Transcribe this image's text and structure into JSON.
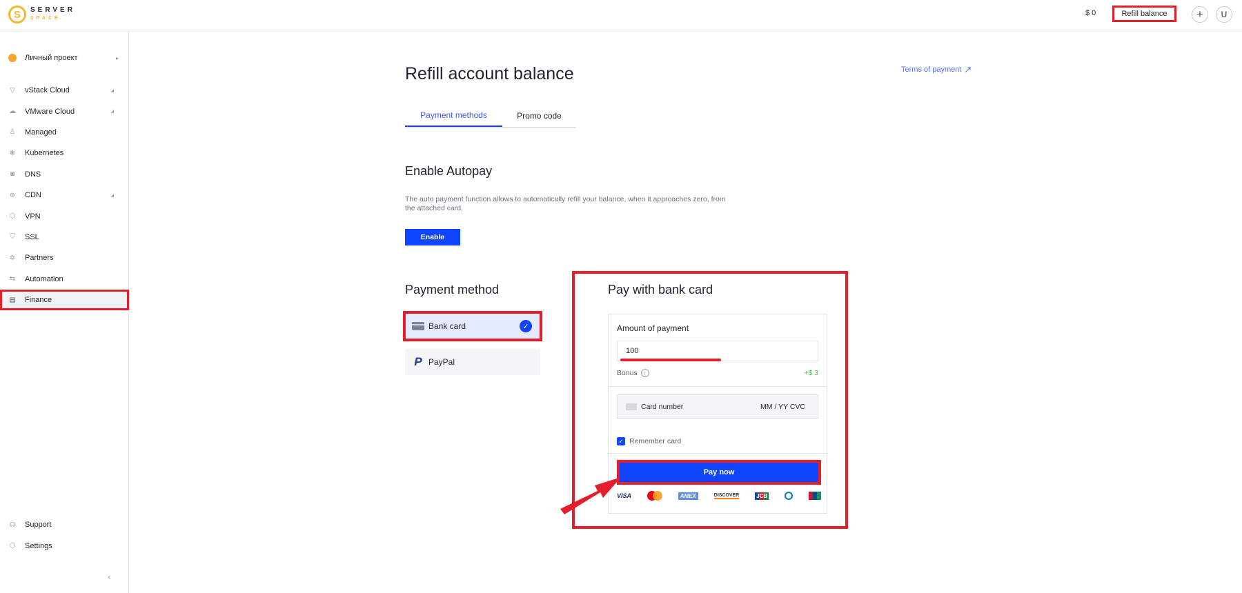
{
  "header": {
    "logo": {
      "line1": "SERVER",
      "line2": "SPACE"
    },
    "balance": "$ 0",
    "refill_button": "Refill balance",
    "add_button": "+",
    "user_initial": "U"
  },
  "sidebar": {
    "project": {
      "label": "Личный проект",
      "arrow": "▸"
    },
    "items": [
      {
        "label": "vStack Cloud",
        "icon": "▽",
        "caret": "◢"
      },
      {
        "label": "VMware Cloud",
        "icon": "☁",
        "caret": "◢"
      },
      {
        "label": "Managed",
        "icon": "♙",
        "caret": ""
      },
      {
        "label": "Kubernetes",
        "icon": "❃",
        "caret": ""
      },
      {
        "label": "DNS",
        "icon": "◙",
        "caret": ""
      },
      {
        "label": "CDN",
        "icon": "⊕",
        "caret": "◢"
      },
      {
        "label": "VPN",
        "icon": "⬡",
        "caret": ""
      },
      {
        "label": "SSL",
        "icon": "⛉",
        "caret": ""
      },
      {
        "label": "Partners",
        "icon": "✲",
        "caret": ""
      },
      {
        "label": "Automation",
        "icon": "⇆",
        "caret": ""
      },
      {
        "label": "Finance",
        "icon": "▤",
        "caret": "",
        "active": true
      }
    ],
    "bottom_items": [
      {
        "label": "Support",
        "icon": "☊"
      },
      {
        "label": "Settings",
        "icon": "⬡"
      }
    ],
    "collapse_icon": "‹"
  },
  "main": {
    "title": "Refill account balance",
    "terms_link": "Terms of payment",
    "terms_arrow": "↗",
    "tabs": [
      {
        "label": "Payment methods",
        "active": true
      },
      {
        "label": "Promo code",
        "active": false
      }
    ],
    "autopay": {
      "title": "Enable Autopay",
      "description": "The auto payment function allows to automatically refill your balance, when it approaches zero, from the attached card.",
      "button": "Enable"
    },
    "payment_method": {
      "title": "Payment method",
      "options": [
        {
          "label": "Bank card",
          "selected": true
        },
        {
          "label": "PayPal",
          "selected": false
        }
      ],
      "check": "✓",
      "paypal_glyph": "P"
    },
    "pay_card": {
      "title": "Pay with bank card",
      "amount_label": "Amount of payment",
      "amount_value": "100",
      "bonus_label": "Bonus",
      "bonus_info": "i",
      "bonus_value": "+$ 3",
      "card_number_placeholder": "Card number",
      "expiry_cvc_placeholder": "MM / YY  CVC",
      "remember_label": "Remember card",
      "remember_checked": true,
      "checkmark": "✓",
      "pay_button": "Pay now",
      "brands": {
        "visa": "VISA",
        "amex": "AMEX",
        "discover": "DISCOVER",
        "jcb": "JCB"
      }
    }
  },
  "colors": {
    "primary": "#0f45ff",
    "accent_link": "#5470ff",
    "annotation_red": "#e41e2b",
    "brand_yellow": "#f5b82e",
    "bonus_green": "#5cb85c"
  }
}
